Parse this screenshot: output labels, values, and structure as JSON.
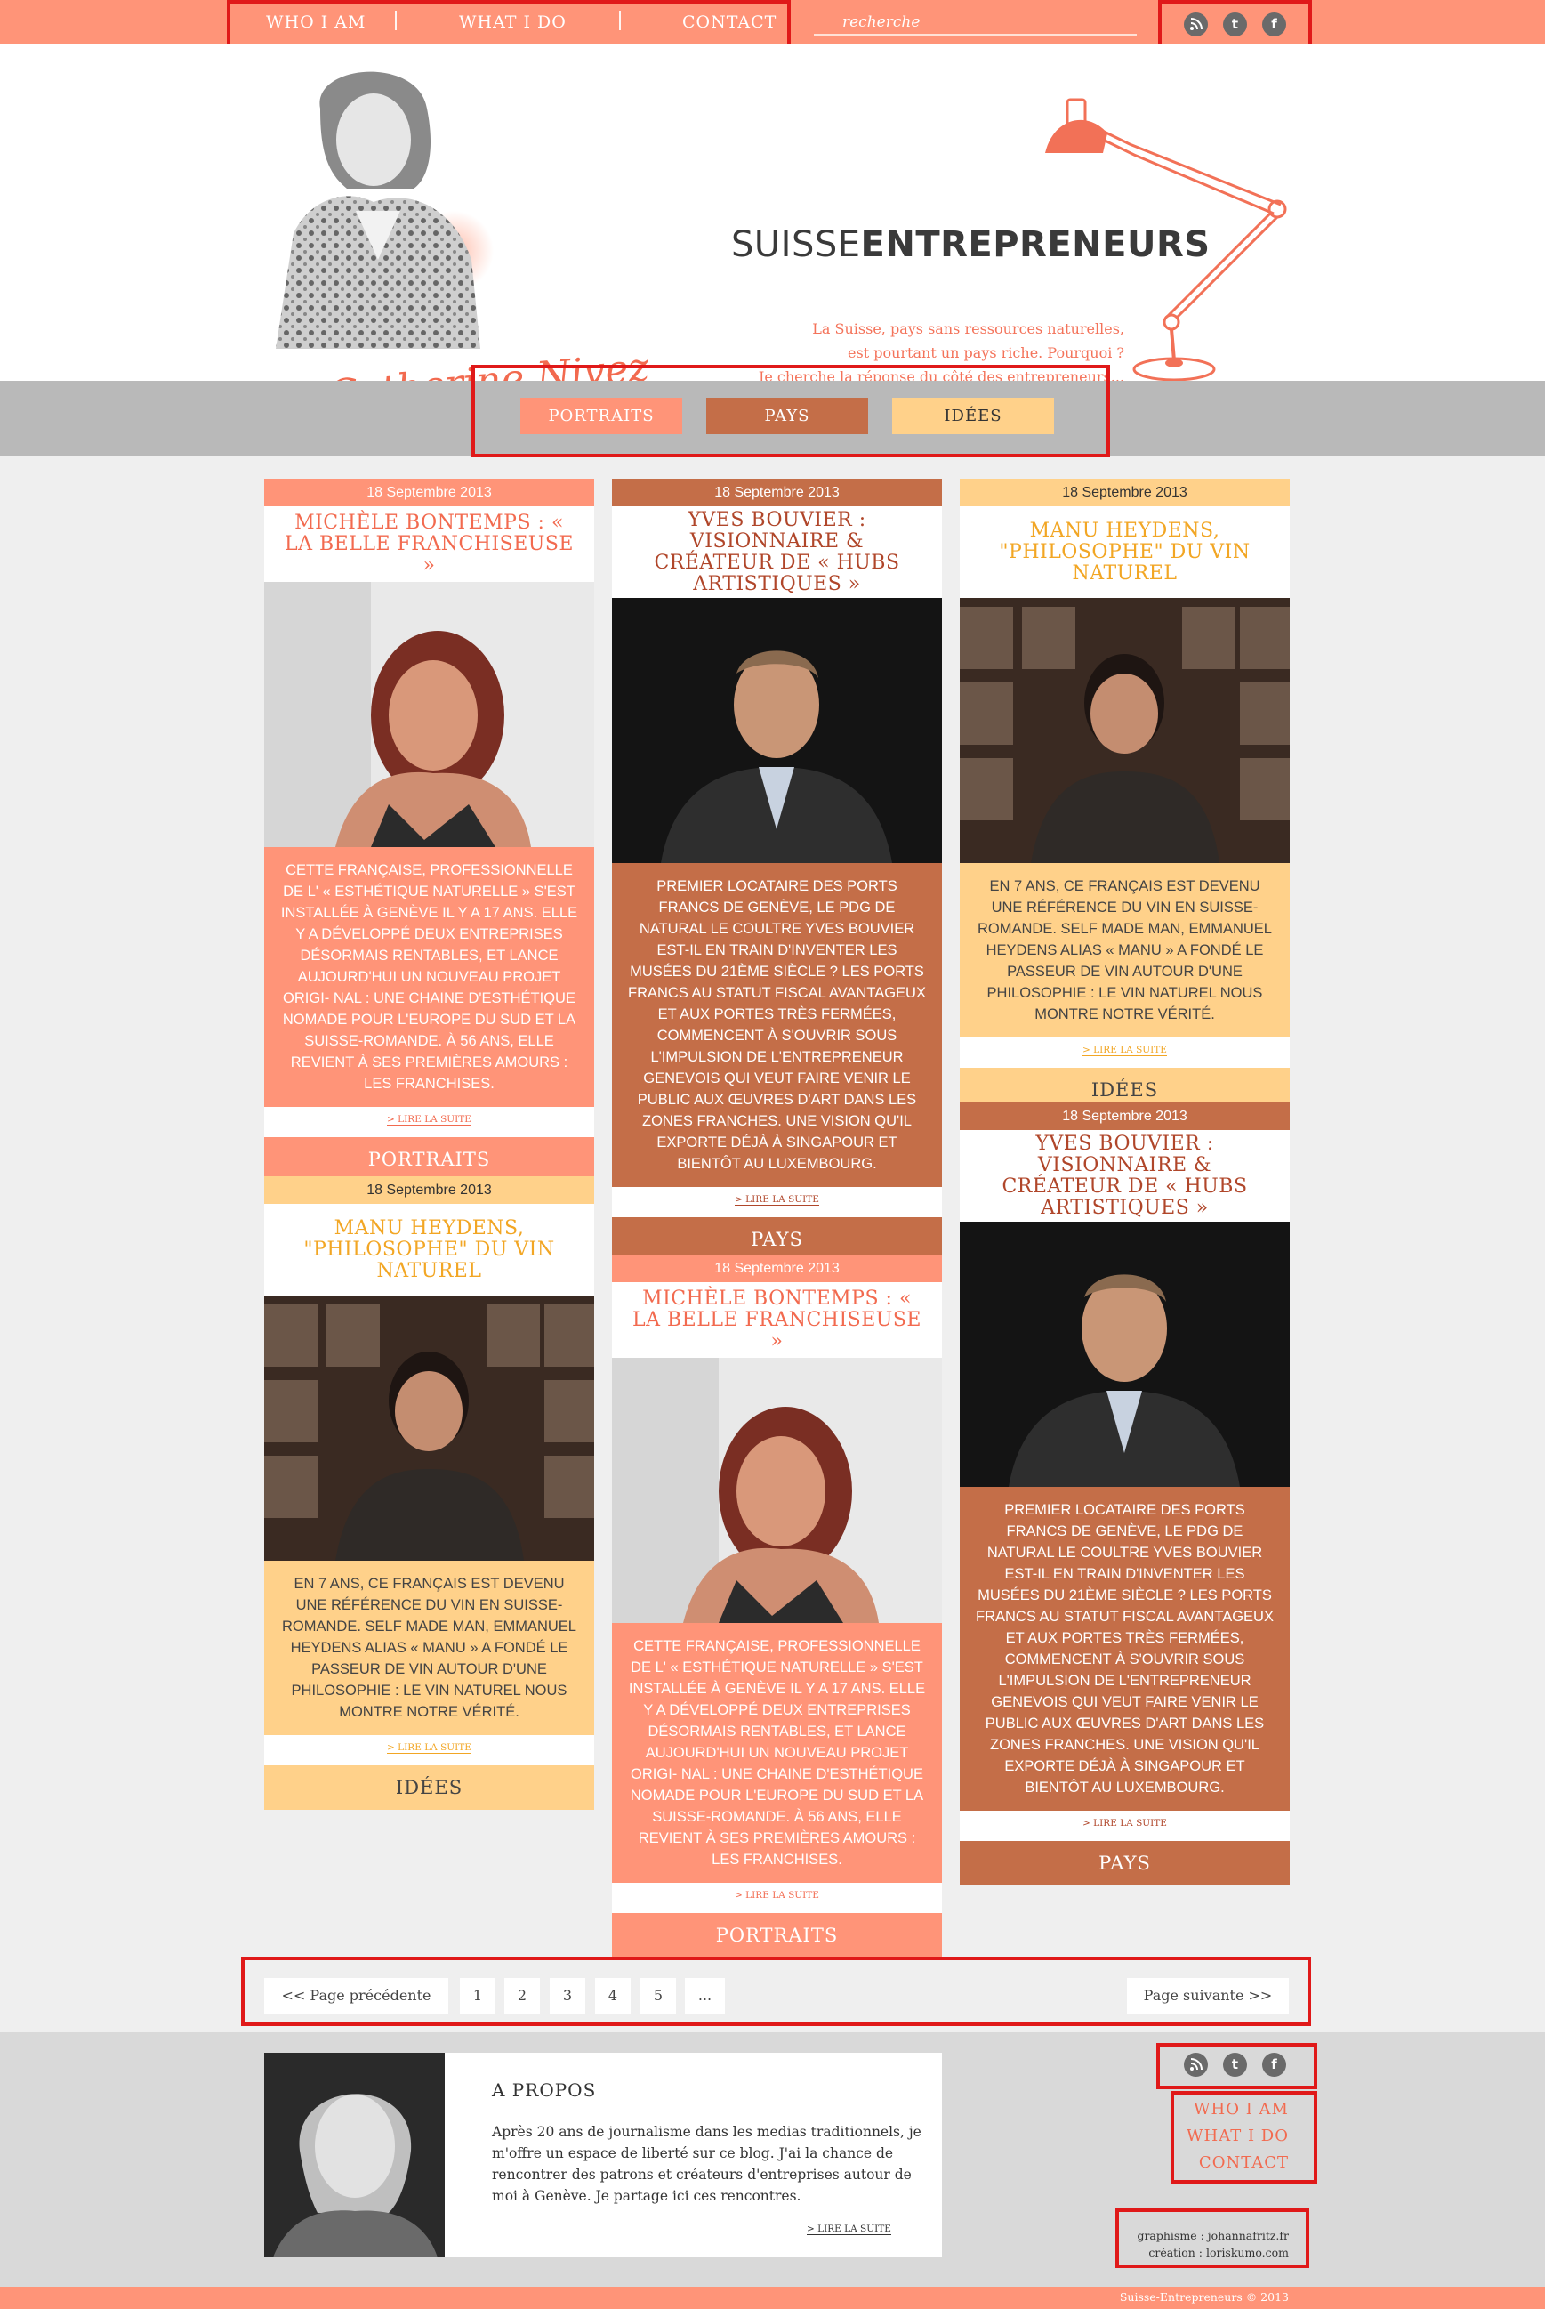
{
  "nav": {
    "items": [
      "WHO I AM",
      "WHAT I DO",
      "CONTACT"
    ],
    "search_placeholder": "recherche"
  },
  "social": [
    "rss-icon",
    "twitter-icon",
    "facebook-icon"
  ],
  "header": {
    "brand_light": "SUISSE",
    "brand_bold": "ENTREPRENEURS",
    "tagline": [
      "La Suisse, pays sans ressources naturelles,",
      "est pourtant un pays riche. Pourquoi ?",
      "Je cherche la réponse du côté des entrepreneurs..."
    ],
    "signature": "Catherine Nivez"
  },
  "filters": [
    "PORTRAITS",
    "PAYS",
    "IDÉES"
  ],
  "colors": {
    "coral": "#ff9478",
    "brown": "#c46e48",
    "yellow": "#ffd18a",
    "coral_title": "#f26a4f",
    "yellow_title": "#f2a624"
  },
  "cards": {
    "c1": {
      "date": "18 Septembre 2013",
      "title": "MICHÈLE BONTEMPS : « LA BELLE FRANCHISEUSE »",
      "excerpt": "CETTE FRANÇAISE, PROFESSIONNELLE DE L' « ESTHÉTIQUE NATURELLE » S'EST INSTALLÉE À GENÈVE IL Y A 17 ANS. ELLE Y A DÉVELOPPÉ DEUX ENTREPRISES DÉSORMAIS RENTABLES, ET LANCE AUJOURD'HUI UN NOUVEAU PROJET ORIGI- NAL : UNE CHAINE D'ESTHÉTIQUE NOMADE POUR L'EUROPE DU SUD ET LA SUISSE-ROMANDE. À 56 ANS, ELLE REVIENT À SES PREMIÈRES AMOURS : LES FRANCHISES.",
      "more": "> LIRE LA SUITE",
      "category": "PORTRAITS"
    },
    "c2": {
      "date": "18 Septembre 2013",
      "title": "MANU HEYDENS, \"PHILOSOPHE\" DU VIN NATUREL",
      "excerpt": "EN 7 ANS, CE FRANÇAIS EST DEVENU UNE RÉFÉRENCE DU VIN EN SUISSE-ROMANDE. SELF MADE MAN, EMMANUEL HEYDENS ALIAS « MANU » A FONDÉ LE PASSEUR DE VIN AUTOUR D'UNE PHILOSOPHIE : LE VIN NATUREL NOUS MONTRE NOTRE VÉRITÉ.",
      "more": "> LIRE LA SUITE",
      "category": "IDÉES"
    },
    "c3": {
      "date": "18 Septembre 2013",
      "title": "YVES BOUVIER : VISIONNAIRE & CRÉATEUR DE « HUBS ARTISTIQUES »",
      "excerpt": "PREMIER LOCATAIRE DES PORTS FRANCS DE GENÈVE, LE PDG DE NATURAL LE COULTRE YVES BOUVIER EST-IL EN TRAIN D'INVENTER LES MUSÉES DU 21ÈME SIÈCLE ? LES PORTS FRANCS AU STATUT FISCAL AVANTAGEUX ET AUX PORTES TRÈS FERMÉES, COMMENCENT À S'OUVRIR SOUS L'IMPULSION DE L'ENTREPRENEUR GENEVOIS QUI VEUT FAIRE VENIR LE PUBLIC AUX ŒUVRES D'ART DANS LES ZONES FRANCHES. UNE VISION QU'IL EXPORTE DÉJÀ À SINGAPOUR ET BIENTÔT AU LUXEMBOURG.",
      "more": "> LIRE LA SUITE",
      "category": "PAYS"
    },
    "c4": {
      "date": "18 Septembre 2013",
      "title": "MICHÈLE BONTEMPS : « LA BELLE FRANCHISEUSE »",
      "excerpt": "CETTE FRANÇAISE, PROFESSIONNELLE DE L' « ESTHÉTIQUE NATURELLE » S'EST INSTALLÉE À GENÈVE IL Y A 17 ANS. ELLE Y A DÉVELOPPÉ DEUX ENTREPRISES DÉSORMAIS RENTABLES, ET LANCE AUJOURD'HUI UN NOUVEAU PROJET ORIGI- NAL : UNE CHAINE D'ESTHÉTIQUE NOMADE POUR L'EUROPE DU SUD ET LA SUISSE-ROMANDE. À 56 ANS, ELLE REVIENT À SES PREMIÈRES AMOURS : LES FRANCHISES.",
      "more": "> LIRE LA SUITE",
      "category": "PORTRAITS"
    },
    "c5": {
      "date": "18 Septembre 2013",
      "title": "MANU HEYDENS, \"PHILOSOPHE\" DU VIN NATUREL",
      "excerpt": "EN 7 ANS, CE FRANÇAIS EST DEVENU UNE RÉFÉRENCE DU VIN EN SUISSE-ROMANDE. SELF MADE MAN, EMMANUEL HEYDENS ALIAS « MANU » A FONDÉ LE PASSEUR DE VIN AUTOUR D'UNE PHILOSOPHIE : LE VIN NATUREL NOUS MONTRE NOTRE VÉRITÉ.",
      "more": "> LIRE LA SUITE",
      "category": "IDÉES"
    },
    "c6": {
      "date": "18 Septembre 2013",
      "title": "YVES BOUVIER : VISIONNAIRE & CRÉATEUR DE « HUBS ARTISTIQUES »",
      "excerpt": "PREMIER LOCATAIRE DES PORTS FRANCS DE GENÈVE, LE PDG DE NATURAL LE COULTRE YVES BOUVIER EST-IL EN TRAIN D'INVENTER LES MUSÉES DU 21ÈME SIÈCLE ? LES PORTS FRANCS AU STATUT FISCAL AVANTAGEUX ET AUX PORTES TRÈS FERMÉES, COMMENCENT À S'OUVRIR SOUS L'IMPULSION DE L'ENTREPRENEUR GENEVOIS QUI VEUT FAIRE VENIR LE PUBLIC AUX ŒUVRES D'ART DANS LES ZONES FRANCHES. UNE VISION QU'IL EXPORTE DÉJÀ À SINGAPOUR ET BIENTÔT AU LUXEMBOURG.",
      "more": "> LIRE LA SUITE",
      "category": "PAYS"
    }
  },
  "pagination": {
    "prev": "<< Page précédente",
    "pages": [
      "1",
      "2",
      "3",
      "4",
      "5",
      "..."
    ],
    "next": "Page suivante >>"
  },
  "footer": {
    "about_title": "A PROPOS",
    "about_text": "Après 20 ans de journalisme dans les medias traditionnels, je m'offre un espace de liberté sur ce blog. J'ai la chance de rencontrer des patrons et créateurs d'entreprises autour de moi à Genève. Je partage ici ces rencontres.",
    "about_more": "> LIRE LA SUITE",
    "links": [
      "WHO I AM",
      "WHAT I DO",
      "CONTACT"
    ],
    "credits": [
      "graphisme : johannafritz.fr",
      "création : loriskumo.com"
    ],
    "copyright": "Suisse-Entrepreneurs © 2013"
  }
}
